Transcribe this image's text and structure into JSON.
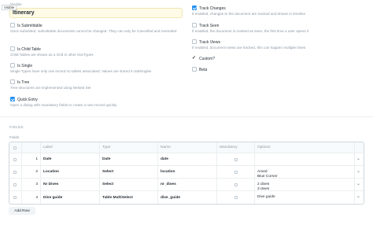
{
  "module_field": {
    "label": "Module",
    "tooltip": "Visible",
    "value": "Itinerary"
  },
  "left_options": [
    {
      "label": "Is Submittable",
      "checked": false,
      "description": "Once submitted, submittable documents cannot be changed. They can only be Cancelled and Amended."
    },
    {
      "label": "Is Child Table",
      "checked": false,
      "description": "Child Tables are shown as a Grid in other DocTypes"
    },
    {
      "label": "Is Single",
      "checked": false,
      "description": "Single Types have only one record no tables associated. Values are stored in tabSingles"
    },
    {
      "label": "Is Tree",
      "checked": false,
      "description": "Tree structures are implemented using Nested Set"
    },
    {
      "label": "Quick Entry",
      "checked": true,
      "description": "Open a dialog with mandatory fields to create a new record quickly"
    }
  ],
  "right_options": [
    {
      "label": "Track Changes",
      "checked": true,
      "description": "If enabled, changes to the document are tracked and shown in timeline"
    },
    {
      "label": "Track Seen",
      "checked": false,
      "description": "If enabled, the document is marked as seen, the first time a user opens it"
    },
    {
      "label": "Track Views",
      "checked": false,
      "description": "If enabled, document views are tracked, this can happen multiple times"
    }
  ],
  "custom": {
    "label": "Custom?"
  },
  "beta": {
    "label": "Beta"
  },
  "fields_section": {
    "title": "FIELDS",
    "caption": "Fields",
    "columns": [
      "Label",
      "Type",
      "Name",
      "Mandatory",
      "Options"
    ],
    "rows": [
      {
        "num": "1",
        "label": "Date",
        "type": "Date",
        "name": "date",
        "options": []
      },
      {
        "num": "2",
        "label": "Location",
        "type": "Select",
        "name": "location",
        "options": [
          "Amed",
          "Blue Corner"
        ]
      },
      {
        "num": "3",
        "label": "Nr Dives",
        "type": "Select",
        "name": "nr_dives",
        "options": [
          "2 dives",
          "3 dives"
        ]
      },
      {
        "num": "4",
        "label": "Dive guide",
        "type": "Table MultiSelect",
        "name": "dive_guide",
        "options": [
          "Dive guide"
        ]
      }
    ],
    "add_row_label": "Add Row"
  },
  "icons": {
    "checkmark": "check-icon",
    "row_edit": "chevron-down-icon"
  }
}
